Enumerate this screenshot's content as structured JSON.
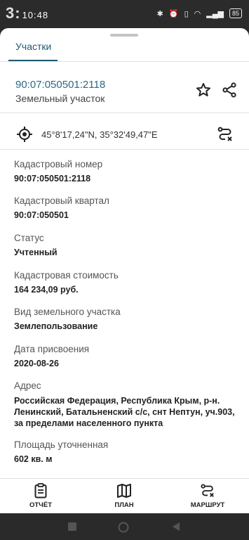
{
  "status_bar": {
    "time_big": "3:",
    "time_small": "10:48",
    "battery": "85",
    "icons": [
      "bluetooth-icon",
      "alarm-icon",
      "vibrate-icon",
      "wifi-icon",
      "signal-icon"
    ]
  },
  "tab": {
    "label": "Участки"
  },
  "parcel": {
    "number": "90:07:050501:2118",
    "type": "Земельный участок"
  },
  "coordinates": "45°8'17,24\"N, 35°32'49,47\"E",
  "fields": [
    {
      "label": "Кадастровый номер",
      "value": "90:07:050501:2118"
    },
    {
      "label": "Кадастровый квартал",
      "value": "90:07:050501"
    },
    {
      "label": "Статус",
      "value": "Учтенный"
    },
    {
      "label": "Кадастровая стоимость",
      "value": "164 234,09 руб."
    },
    {
      "label": "Вид земельного участка",
      "value": "Землепользование"
    },
    {
      "label": "Дата присвоения",
      "value": "2020-08-26"
    },
    {
      "label": "Адрес",
      "value": " Российская Федерация, Республика Крым, р-н. Ленинский, Батальненский с/с,  снт Нептун, уч.903, за пределами населенного пункта"
    },
    {
      "label": "Площадь уточненная",
      "value": "602 кв. м"
    }
  ],
  "bottom_nav": [
    {
      "label": "ОТЧЁТ",
      "icon": "report-icon"
    },
    {
      "label": "ПЛАН",
      "icon": "map-icon"
    },
    {
      "label": "МАРШРУТ",
      "icon": "route-icon"
    }
  ],
  "colors": {
    "accent": "#1e5a74",
    "link": "#2b6a86"
  }
}
